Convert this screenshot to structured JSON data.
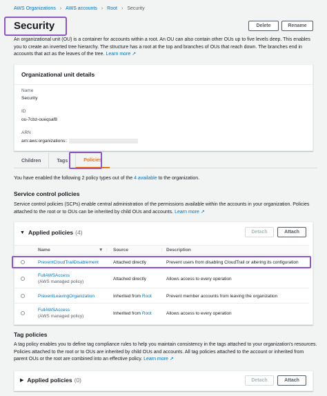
{
  "breadcrumb": [
    "AWS Organizations",
    "AWS accounts",
    "Root",
    "Security"
  ],
  "page": {
    "title": "Security",
    "delete_label": "Delete",
    "rename_label": "Rename",
    "intro": "An organizational unit (OU) is a container for accounts within a root. An OU can also contain other OUs up to five levels deep. This enables you to create an inverted tree hierarchy. The structure has a root at the top and branches of OUs that reach down. The branches end in accounts that act as the leaves of the tree.",
    "learn_more": "Learn more"
  },
  "details": {
    "heading": "Organizational unit details",
    "name_label": "Name",
    "name_value": "Security",
    "id_label": "ID",
    "id_value": "ou-7cbz-oueqsaf8",
    "arn_label": "ARN",
    "arn_value": "arn:aws:organizations::"
  },
  "tabs": [
    "Children",
    "Tags",
    "Policies"
  ],
  "policy_notice": {
    "before": "You have enabled the following 2 policy types out of the ",
    "link": "4 available",
    "after": " to the organization."
  },
  "scp": {
    "heading": "Service control policies",
    "description": "Service control policies (SCPs) enable central administration of the permissions available within the accounts in your organization. Policies attached to the root or to OUs can be inherited by child OUs and accounts.",
    "learn_more": "Learn more",
    "panel_title": "Applied policies",
    "panel_count": "(4)",
    "detach_label": "Detach",
    "attach_label": "Attach",
    "columns": {
      "name": "Name",
      "source": "Source",
      "description": "Description"
    },
    "rows": [
      {
        "name": "PreventCloudTrailDisablement",
        "sub": "",
        "source": "Attached directly",
        "source_link": "",
        "description": "Prevent users from disabling CloudTrail or altering its configuration"
      },
      {
        "name": "FullAWSAccess",
        "sub": "(AWS managed policy)",
        "source": "Attached directly",
        "source_link": "",
        "description": "Allows access to every operation"
      },
      {
        "name": "PreventLeavingOrganization",
        "sub": "",
        "source": "Inherited from ",
        "source_link": "Root",
        "description": "Prevent member accounts from leaving the organization"
      },
      {
        "name": "FullAWSAccess",
        "sub": "(AWS managed policy)",
        "source": "Inherited from ",
        "source_link": "Root",
        "description": "Allows access to every operation"
      }
    ]
  },
  "tag_policies": {
    "heading": "Tag policies",
    "description": "A tag policy enables you to define tag compliance rules to help you maintain consistency in the tags attached to your organization's resources. Policies attached to the root or to OUs are inherited by child OUs and accounts. All tag policies attached to the account or inherited from parent OUs or the root are combined into an effective policy.",
    "learn_more": "Learn more",
    "panel_title": "Applied policies",
    "panel_count": "(0)",
    "detach_label": "Detach",
    "attach_label": "Attach"
  }
}
